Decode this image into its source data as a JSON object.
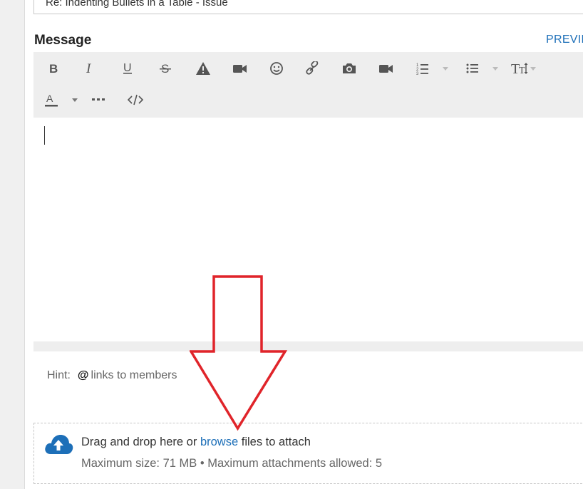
{
  "subject": {
    "value": "Re: Indenting Bullets in a Table - Issue"
  },
  "message": {
    "label": "Message",
    "preview_label": "PREVIE"
  },
  "toolbar": {
    "row1": [
      "bold-icon",
      "italic-icon",
      "underline-icon",
      "strikethrough-icon",
      "warning-icon",
      "video-icon",
      "emoji-icon",
      "link-icon",
      "camera-icon",
      "video-icon",
      "numbered-list-icon",
      "bullet-list-icon",
      "text-size-icon"
    ],
    "row2": [
      "font-color-icon",
      "more-icon",
      "source-code-icon"
    ]
  },
  "hint": {
    "prefix": "Hint:",
    "symbol": "@",
    "text": "links to members"
  },
  "attach": {
    "main_prefix": "Drag and drop here or",
    "browse": "browse",
    "main_suffix": "files to attach",
    "sub": "Maximum size: 71 MB • Maximum attachments allowed: 5"
  },
  "colors": {
    "accent": "#1d6fb8",
    "toolbar_bg": "#eeeeee",
    "annotation_arrow": "#e0242a"
  }
}
